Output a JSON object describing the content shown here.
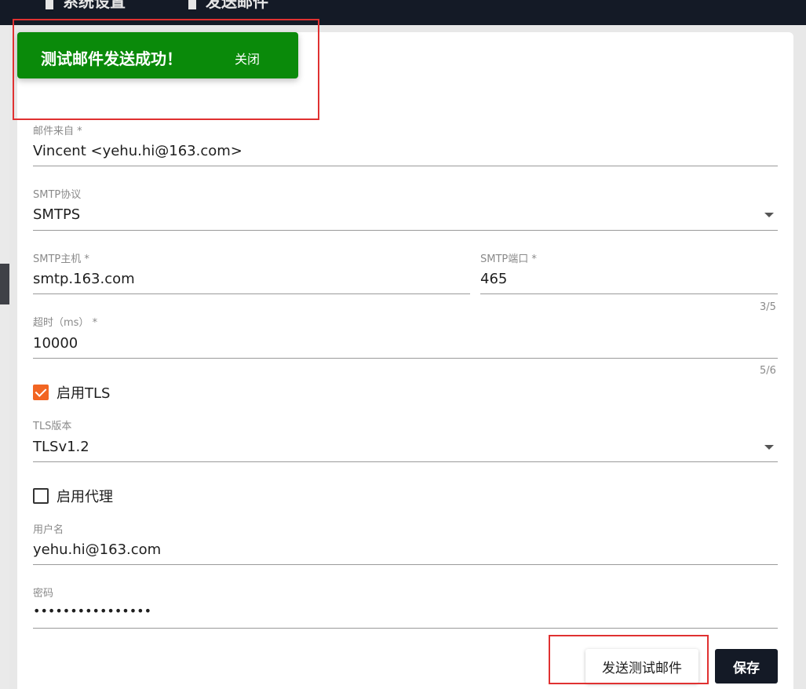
{
  "header": {
    "breadcrumb_1": "系统设置",
    "breadcrumb_2": "发送邮件"
  },
  "toast": {
    "message": "测试邮件发送成功！",
    "close_label": "关闭"
  },
  "form": {
    "from": {
      "label": "邮件来自 *",
      "value": "Vincent <yehu.hi@163.com>"
    },
    "protocol": {
      "label": "SMTP协议",
      "value": "SMTPS"
    },
    "host": {
      "label": "SMTP主机 *",
      "value": "smtp.163.com"
    },
    "port": {
      "label": "SMTP端口 *",
      "value": "465",
      "counter": "3/5"
    },
    "timeout": {
      "label": "超时（ms） *",
      "value": "10000",
      "counter": "5/6"
    },
    "enable_tls": {
      "label": "启用TLS",
      "checked": true
    },
    "tls_version": {
      "label": "TLS版本",
      "value": "TLSv1.2"
    },
    "enable_proxy": {
      "label": "启用代理",
      "checked": false
    },
    "username": {
      "label": "用户名",
      "value": "yehu.hi@163.com"
    },
    "password": {
      "label": "密码",
      "value": "••••••••••••••••"
    }
  },
  "actions": {
    "send_test_label": "发送测试邮件",
    "save_label": "保存"
  },
  "colors": {
    "toast_bg": "#0a8a0a",
    "accent": "#f26522",
    "header_bg": "#141a26",
    "highlight": "#e03131"
  }
}
